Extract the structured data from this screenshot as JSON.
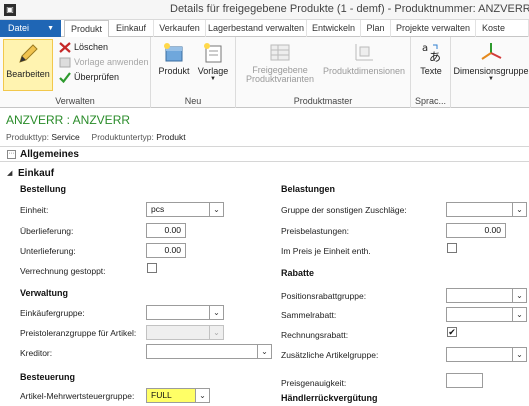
{
  "window": {
    "title": "Details für freigegebene Produkte (1 - demf) - Produktnummer: ANZVERR",
    "app_icon": "dynamics-ax-icon"
  },
  "tabs": {
    "file_label": "Datei",
    "items": [
      "Produkt",
      "Einkauf",
      "Verkaufen",
      "Lagerbestand verwalten",
      "Entwickeln",
      "Plan",
      "Projekte verwalten",
      "Koste"
    ],
    "active": "Produkt"
  },
  "ribbon": {
    "verwalten": {
      "label": "Verwalten",
      "edit": "Bearbeiten",
      "delete": "Löschen",
      "template_apply": "Vorlage anwenden",
      "validate": "Überprüfen"
    },
    "neu": {
      "label": "Neu",
      "product": "Produkt",
      "template": "Vorlage"
    },
    "produktmaster": {
      "label": "Produktmaster",
      "released_variants": "Freigegebene Produktvarianten",
      "dimensions": "Produktdimensionen"
    },
    "sprache": {
      "label": "Sprac...",
      "texts": "Texte"
    },
    "dimension_groups": "Dimensionsgruppe"
  },
  "header": {
    "record_title": "ANZVERR : ANZVERR",
    "product_type_label": "Produkttyp:",
    "product_type_value": "Service",
    "product_subtype_label": "Produktuntertyp:",
    "product_subtype_value": "Produkt"
  },
  "fasttabs": {
    "general": "Allgemeines",
    "purchase": "Einkauf"
  },
  "left": {
    "order_head": "Bestellung",
    "unit_label": "Einheit:",
    "unit_value": "pcs",
    "over_label": "Überlieferung:",
    "over_value": "0.00",
    "under_label": "Unterlieferung:",
    "under_value": "0.00",
    "settle_label": "Verrechnung gestoppt:",
    "admin_head": "Verwaltung",
    "buyer_group_label": "Einkäufergruppe:",
    "buyer_group_value": "",
    "price_tol_label": "Preistoleranzgruppe für Artikel:",
    "price_tol_value": "",
    "vendor_label": "Kreditor:",
    "vendor_value": "",
    "tax_head": "Besteuerung",
    "vat_label": "Artikel-Mehrwertsteuergruppe:",
    "vat_value": "FULL"
  },
  "right": {
    "charges_head": "Belastungen",
    "misc_group_label": "Gruppe der sonstigen Zuschläge:",
    "misc_group_value": "",
    "price_charges_label": "Preisbelastungen:",
    "price_charges_value": "0.00",
    "per_unit_label": "Im Preis je Einheit enth.",
    "discounts_head": "Rabatte",
    "line_disc_label": "Positionsrabattgruppe:",
    "line_disc_value": "",
    "multi_disc_label": "Sammelrabatt:",
    "multi_disc_value": "",
    "invoice_disc_label": "Rechnungsrabatt:",
    "invoice_disc_checked": "✔",
    "extra_group_label": "Zusätzliche Artikelgruppe:",
    "extra_group_value": "",
    "price_prec_label": "Preisgenauigkeit:",
    "price_prec_value": "",
    "rebate_head": "Händlerrückvergütung"
  }
}
